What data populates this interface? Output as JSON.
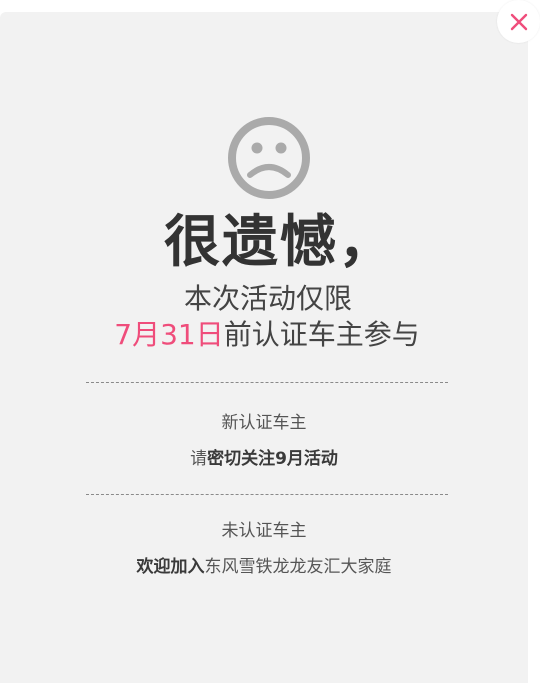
{
  "dialog": {
    "close_icon": "close-x-icon",
    "face_icon": "sad-face-icon",
    "headline": "很遗憾，",
    "subtitle_line1": "本次活动仅限",
    "subtitle_date": "7月31日",
    "subtitle_rest": "前认证车主参与",
    "new_owner": {
      "title": "新认证车主",
      "prefix": "请",
      "emphasis": "密切关注9月活动"
    },
    "unverified_owner": {
      "title": "未认证车主",
      "emphasis": "欢迎加入",
      "rest": "东风雪铁龙龙友汇大家庭"
    }
  },
  "colors": {
    "accent": "#ef4d7b",
    "card_bg": "#f2f2f2",
    "icon_gray": "#aaaaaa"
  }
}
